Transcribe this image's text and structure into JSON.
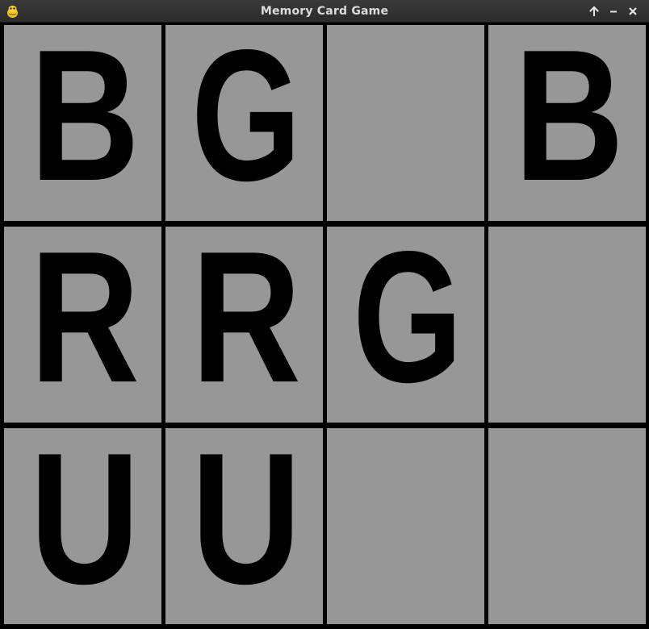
{
  "window": {
    "title": "Memory Card Game",
    "app_icon": "pygame-snake-icon",
    "controls": [
      {
        "name": "maximize-button",
        "icon": "arrow-up-icon",
        "glyph": "↑"
      },
      {
        "name": "minimize-button",
        "icon": "minus-icon",
        "glyph": "–"
      },
      {
        "name": "close-button",
        "icon": "close-icon",
        "glyph": "✕"
      }
    ]
  },
  "colors": {
    "titlebar": "#2e2e2e",
    "title_text": "#dcdcdc",
    "card_face": "#979797",
    "grid_line": "#000000",
    "letter": "#000000"
  },
  "board": {
    "rows": 3,
    "columns": 4,
    "cards": [
      {
        "row": 1,
        "col": 1,
        "revealed": true,
        "letter": "B"
      },
      {
        "row": 1,
        "col": 2,
        "revealed": true,
        "letter": "G"
      },
      {
        "row": 1,
        "col": 3,
        "revealed": false,
        "letter": ""
      },
      {
        "row": 1,
        "col": 4,
        "revealed": true,
        "letter": "B"
      },
      {
        "row": 2,
        "col": 1,
        "revealed": true,
        "letter": "R"
      },
      {
        "row": 2,
        "col": 2,
        "revealed": true,
        "letter": "R"
      },
      {
        "row": 2,
        "col": 3,
        "revealed": true,
        "letter": "G"
      },
      {
        "row": 2,
        "col": 4,
        "revealed": false,
        "letter": ""
      },
      {
        "row": 3,
        "col": 1,
        "revealed": true,
        "letter": "U"
      },
      {
        "row": 3,
        "col": 2,
        "revealed": true,
        "letter": "U"
      },
      {
        "row": 3,
        "col": 3,
        "revealed": false,
        "letter": ""
      },
      {
        "row": 3,
        "col": 4,
        "revealed": false,
        "letter": ""
      }
    ]
  }
}
